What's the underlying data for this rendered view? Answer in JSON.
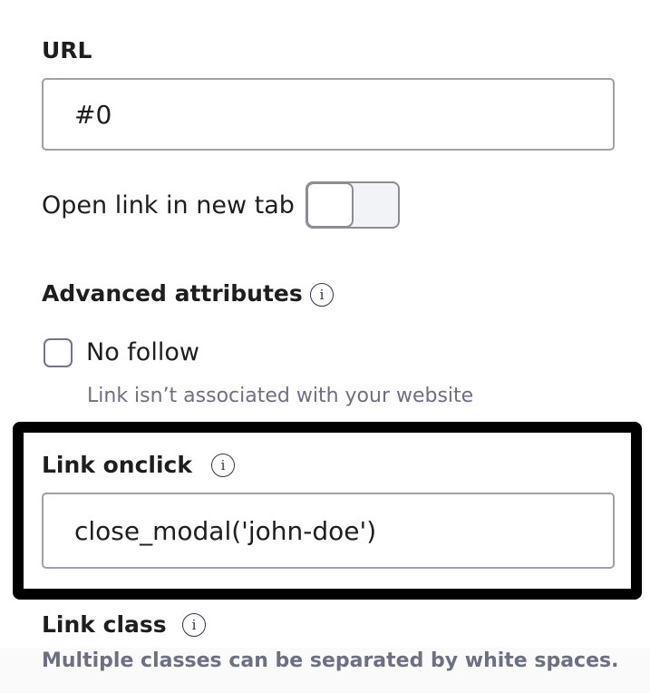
{
  "url": {
    "label": "URL",
    "value": "#0"
  },
  "new_tab": {
    "label": "Open link in new tab",
    "enabled": false
  },
  "advanced": {
    "label": "Advanced attributes",
    "info_icon": "info-icon"
  },
  "no_follow": {
    "label": "No follow",
    "description": "Link isn’t associated with your website",
    "checked": false
  },
  "onclick": {
    "label": "Link onclick",
    "value": "close_modal('john-doe')",
    "info_icon": "info-icon"
  },
  "link_class": {
    "label": "Link class",
    "description": "Multiple classes can be separated by white spaces.",
    "info_icon": "info-icon"
  },
  "colors": {
    "text": "#1d1e20",
    "muted": "#6d7081",
    "border": "#a0a0a8",
    "highlight": "#000000"
  }
}
